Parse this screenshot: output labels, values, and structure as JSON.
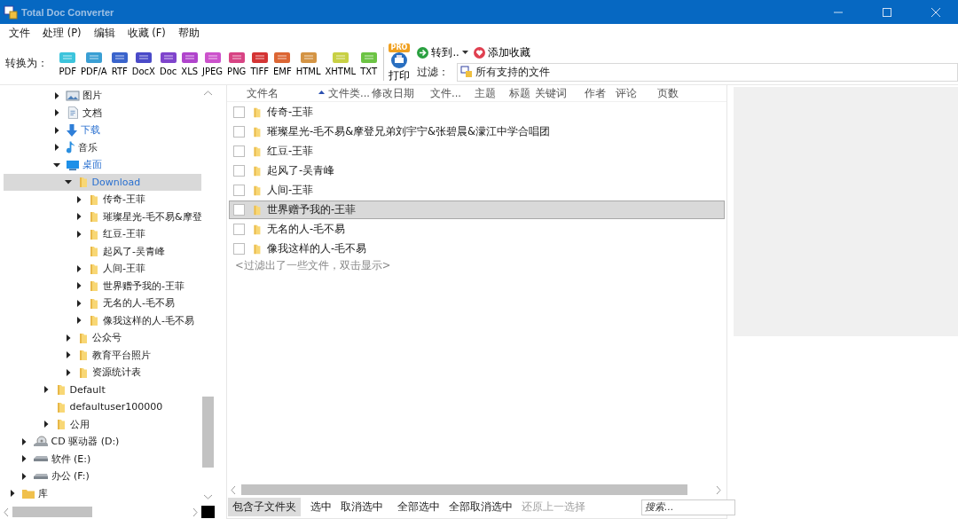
{
  "window": {
    "title": "Total Doc Converter"
  },
  "menu": [
    "文件",
    "处理 (P)",
    "编辑",
    "收藏 (F)",
    "帮助"
  ],
  "toolbar": {
    "convert_label": "转换为：",
    "formats": [
      {
        "label": "PDF",
        "color": "#3cc4dc"
      },
      {
        "label": "PDF/A",
        "color": "#3a9fd4"
      },
      {
        "label": "RTF",
        "color": "#3a64cc"
      },
      {
        "label": "DocX",
        "color": "#4a4ac8"
      },
      {
        "label": "Doc",
        "color": "#7f44cc"
      },
      {
        "label": "XLS",
        "color": "#b044cc"
      },
      {
        "label": "JPEG",
        "color": "#cc52cc"
      },
      {
        "label": "PNG",
        "color": "#d84484"
      },
      {
        "label": "TIFF",
        "color": "#d43434"
      },
      {
        "label": "EMF",
        "color": "#dc6634"
      },
      {
        "label": "HTML",
        "color": "#d49444"
      },
      {
        "label": "XHTML",
        "color": "#c8d044"
      },
      {
        "label": "TXT",
        "color": "#6cc444"
      }
    ],
    "print": {
      "label": "打印",
      "badge": "PRO"
    },
    "goto": "转到..",
    "favorite": "添加收藏",
    "filter_label": "过滤：",
    "filter_value": "所有支持的文件"
  },
  "tree": [
    {
      "children": [
        {
          "children": [
            {
              "children": [
                {
                  "children": [
                    {
                      "label": "图片",
                      "kind": "pictures",
                      "expanded": false,
                      "accent": false,
                      "selected": false
                    },
                    {
                      "label": "文档",
                      "kind": "documents",
                      "expanded": false,
                      "accent": false,
                      "selected": false
                    },
                    {
                      "label": "下载",
                      "kind": "downloads",
                      "expanded": false,
                      "accent": true,
                      "selected": false
                    },
                    {
                      "label": "音乐",
                      "kind": "music",
                      "expanded": false,
                      "accent": false,
                      "selected": false
                    },
                    {
                      "label": "桌面",
                      "kind": "desktop",
                      "expanded": true,
                      "accent": true,
                      "selected": false,
                      "children": [
                        {
                          "label": "Download",
                          "kind": "folder",
                          "expanded": true,
                          "accent": false,
                          "selected": true,
                          "children": [
                            {
                              "label": "传奇-王菲",
                              "kind": "folder",
                              "expanded": false,
                              "accent": false,
                              "selected": false
                            },
                            {
                              "label": "璀璨星光-毛不易&摩登",
                              "kind": "folder",
                              "expanded": false,
                              "accent": false,
                              "selected": false
                            },
                            {
                              "label": "红豆-王菲",
                              "kind": "folder",
                              "expanded": false,
                              "accent": false,
                              "selected": false
                            },
                            {
                              "label": "起风了-吴青峰",
                              "kind": "folder",
                              "accent": false,
                              "selected": false
                            },
                            {
                              "label": "人间-王菲",
                              "kind": "folder",
                              "expanded": false,
                              "accent": false,
                              "selected": false
                            },
                            {
                              "label": "世界赠予我的-王菲",
                              "kind": "folder",
                              "expanded": false,
                              "accent": false,
                              "selected": false
                            },
                            {
                              "label": "无名的人-毛不易",
                              "kind": "folder",
                              "expanded": false,
                              "accent": false,
                              "selected": false
                            },
                            {
                              "label": "像我这样的人-毛不易",
                              "kind": "folder",
                              "expanded": false,
                              "accent": false,
                              "selected": false
                            }
                          ]
                        },
                        {
                          "label": "公众号",
                          "kind": "folder",
                          "expanded": false,
                          "accent": false,
                          "selected": false
                        },
                        {
                          "label": "教育平台照片",
                          "kind": "folder",
                          "expanded": false,
                          "accent": false,
                          "selected": false
                        },
                        {
                          "label": "资源统计表",
                          "kind": "folder",
                          "expanded": false,
                          "accent": false,
                          "selected": false
                        }
                      ]
                    }
                  ]
                },
                {
                  "label": "Default",
                  "kind": "folder",
                  "expanded": false,
                  "accent": false,
                  "selected": false
                },
                {
                  "label": "defaultuser100000",
                  "kind": "folder",
                  "accent": false,
                  "selected": false
                },
                {
                  "label": "公用",
                  "kind": "folder",
                  "expanded": false,
                  "accent": false,
                  "selected": false
                }
              ]
            }
          ]
        },
        {
          "label": "CD 驱动器 (D:)",
          "kind": "cd",
          "expanded": false,
          "accent": false,
          "selected": false
        },
        {
          "label": "软件 (E:)",
          "kind": "drive",
          "expanded": false,
          "accent": false,
          "selected": false
        },
        {
          "label": "办公 (F:)",
          "kind": "drive",
          "expanded": false,
          "accent": false,
          "selected": false
        }
      ]
    },
    {
      "label": "库",
      "kind": "library",
      "expanded": false,
      "accent": false,
      "selected": false
    }
  ],
  "file_list": {
    "columns": [
      {
        "label": "文件名",
        "sorted": true
      },
      {
        "label": "文件类...",
        "sorted": false
      },
      {
        "label": "修改日期",
        "sorted": false
      },
      {
        "label": "文件...",
        "sorted": false
      },
      {
        "label": "主题",
        "sorted": false
      },
      {
        "label": "标题",
        "sorted": false
      },
      {
        "label": "关键词",
        "sorted": false
      },
      {
        "label": "作者",
        "sorted": false
      },
      {
        "label": "评论",
        "sorted": false
      },
      {
        "label": "页数",
        "sorted": false
      }
    ],
    "rows": [
      {
        "name": "传奇-王菲",
        "checked": false,
        "selected": false
      },
      {
        "name": "璀璨星光-毛不易&摩登兄弟刘宇宁&张碧晨&濛江中学合唱团",
        "checked": false,
        "selected": false
      },
      {
        "name": "红豆-王菲",
        "checked": false,
        "selected": false
      },
      {
        "name": "起风了-吴青峰",
        "checked": false,
        "selected": false
      },
      {
        "name": "人间-王菲",
        "checked": false,
        "selected": false
      },
      {
        "name": "世界赠予我的-王菲",
        "checked": false,
        "selected": true
      },
      {
        "name": "无名的人-毛不易",
        "checked": false,
        "selected": false
      },
      {
        "name": "像我这样的人-毛不易",
        "checked": false,
        "selected": false
      }
    ],
    "note": "<过滤出了一些文件，双击显示>"
  },
  "bottom_bar": {
    "groups": [
      [
        {
          "label": "包含子文件夹",
          "pressed": true,
          "disabled": false
        }
      ],
      [
        {
          "label": "选中",
          "pressed": false,
          "disabled": false
        },
        {
          "label": "取消选中",
          "pressed": false,
          "disabled": false
        }
      ],
      [
        {
          "label": "全部选中",
          "pressed": false,
          "disabled": false
        },
        {
          "label": "全部取消选中",
          "pressed": false,
          "disabled": false
        },
        {
          "label": "还原上一选择",
          "pressed": false,
          "disabled": true
        }
      ]
    ],
    "search": {
      "placeholder": "搜索..."
    }
  }
}
